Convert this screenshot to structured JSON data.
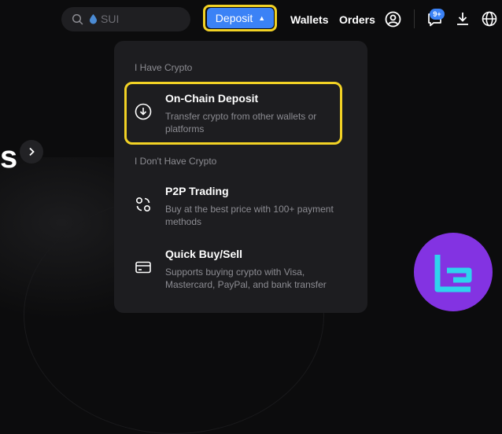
{
  "search": {
    "placeholder": "SUI"
  },
  "nav": {
    "deposit_label": "Deposit",
    "wallets_label": "Wallets",
    "orders_label": "Orders",
    "notification_count": "9+"
  },
  "hero": {
    "fragment": "s"
  },
  "deposit_menu": {
    "have_crypto_label": "I Have Crypto",
    "dont_have_crypto_label": "I Don't Have Crypto",
    "items": [
      {
        "title": "On-Chain Deposit",
        "description": "Transfer crypto from other wallets or platforms",
        "icon": "download-circle-icon"
      },
      {
        "title": "P2P Trading",
        "description": "Buy at the best price with 100+ payment methods",
        "icon": "p2p-icon"
      },
      {
        "title": "Quick Buy/Sell",
        "description": "Supports buying crypto with Visa, Mastercard, PayPal, and bank transfer",
        "icon": "card-icon"
      }
    ]
  },
  "colors": {
    "accent": "#3b82f6",
    "highlight": "#f2d225",
    "logo": "#8333e2"
  }
}
